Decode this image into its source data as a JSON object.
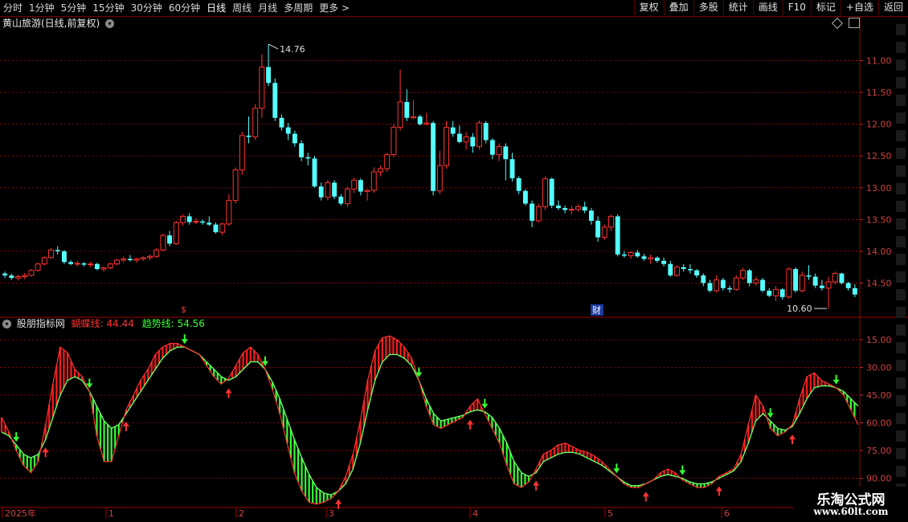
{
  "toolbar": {
    "periods": [
      "分时",
      "1分钟",
      "5分钟",
      "15分钟",
      "30分钟",
      "60分钟",
      "日线",
      "周线",
      "月线",
      "多周期",
      "更多 >"
    ],
    "active_period": "日线",
    "tools": [
      "复权",
      "叠加",
      "多股",
      "统计",
      "画线",
      "F10",
      "标记",
      "+自选",
      "返回"
    ]
  },
  "header": {
    "title": "黄山旅游(日线,前复权)"
  },
  "price_panel": {
    "y_ticks": [
      "14.50",
      "14.00",
      "13.50",
      "13.00",
      "12.50",
      "12.00",
      "11.50",
      "11.00"
    ],
    "high_label": "14.76",
    "low_label": "10.60",
    "markers": [
      "$",
      "财"
    ]
  },
  "indicator": {
    "name": "股朋指标网",
    "line1_label": "蝴蝶线: 44.44",
    "line2_label": "趋势线: 54.56",
    "y_ticks": [
      "90.00",
      "75.00",
      "60.00",
      "45.00",
      "30.00",
      "15.00"
    ]
  },
  "x_axis": {
    "labels": [
      "2025年",
      "1",
      "2",
      "3",
      "4",
      "5",
      "6"
    ]
  },
  "watermark": {
    "line1": "乐淘公式网",
    "line2": "www.60lt.com"
  },
  "colors": {
    "up": "#ff3232",
    "down": "#54ffff",
    "grid": "#8b0000",
    "indicator_up": "#ff1a1a",
    "indicator_down": "#33ff33",
    "trend_line": "#ff3333",
    "label_red": "#ff3333"
  },
  "chart_data": [
    {
      "type": "candlestick",
      "title": "黄山旅游(日线,前复权)",
      "ylim": [
        10.5,
        15.0
      ],
      "y_ticks": [
        11.0,
        11.5,
        12.0,
        12.5,
        13.0,
        13.5,
        14.0,
        14.5
      ],
      "max_price": 14.76,
      "min_price": 10.6,
      "ohlc": [
        [
          11.15,
          11.18,
          11.08,
          11.12
        ],
        [
          11.12,
          11.15,
          11.05,
          11.08
        ],
        [
          11.08,
          11.13,
          11.04,
          11.1
        ],
        [
          11.1,
          11.16,
          11.06,
          11.12
        ],
        [
          11.12,
          11.22,
          11.1,
          11.2
        ],
        [
          11.2,
          11.32,
          11.18,
          11.3
        ],
        [
          11.3,
          11.42,
          11.28,
          11.4
        ],
        [
          11.4,
          11.55,
          11.38,
          11.52
        ],
        [
          11.52,
          11.58,
          11.45,
          11.5
        ],
        [
          11.5,
          11.52,
          11.3,
          11.33
        ],
        [
          11.33,
          11.36,
          11.28,
          11.3
        ],
        [
          11.3,
          11.35,
          11.26,
          11.31
        ],
        [
          11.31,
          11.33,
          11.26,
          11.29
        ],
        [
          11.29,
          11.34,
          11.25,
          11.3
        ],
        [
          11.3,
          11.32,
          11.2,
          11.22
        ],
        [
          11.22,
          11.26,
          11.18,
          11.24
        ],
        [
          11.24,
          11.32,
          11.22,
          11.3
        ],
        [
          11.3,
          11.38,
          11.28,
          11.36
        ],
        [
          11.36,
          11.42,
          11.32,
          11.38
        ],
        [
          11.38,
          11.44,
          11.34,
          11.36
        ],
        [
          11.36,
          11.4,
          11.32,
          11.38
        ],
        [
          11.38,
          11.42,
          11.35,
          11.4
        ],
        [
          11.4,
          11.45,
          11.36,
          11.42
        ],
        [
          11.42,
          11.55,
          11.4,
          11.52
        ],
        [
          11.52,
          11.78,
          11.5,
          11.75
        ],
        [
          11.75,
          11.82,
          11.58,
          11.62
        ],
        [
          11.62,
          11.98,
          11.6,
          11.95
        ],
        [
          11.95,
          12.08,
          11.9,
          12.05
        ],
        [
          12.05,
          12.1,
          11.92,
          11.96
        ],
        [
          11.96,
          12.02,
          11.93,
          11.97
        ],
        [
          11.97,
          12.0,
          11.92,
          11.95
        ],
        [
          11.95,
          12.05,
          11.9,
          11.92
        ],
        [
          11.92,
          11.95,
          11.78,
          11.8
        ],
        [
          11.8,
          11.95,
          11.75,
          11.93
        ],
        [
          11.93,
          12.4,
          11.9,
          12.3
        ],
        [
          12.3,
          12.82,
          12.25,
          12.78
        ],
        [
          12.78,
          13.38,
          12.7,
          13.32
        ],
        [
          13.32,
          13.62,
          13.2,
          13.3
        ],
        [
          13.3,
          13.82,
          13.25,
          13.75
        ],
        [
          13.75,
          14.6,
          13.6,
          14.4
        ],
        [
          14.4,
          14.76,
          14.1,
          14.15
        ],
        [
          14.15,
          14.22,
          13.55,
          13.6
        ],
        [
          13.6,
          13.65,
          13.4,
          13.45
        ],
        [
          13.45,
          13.52,
          13.25,
          13.35
        ],
        [
          13.35,
          13.4,
          13.15,
          13.2
        ],
        [
          13.2,
          13.25,
          12.92,
          12.98
        ],
        [
          12.98,
          13.05,
          12.85,
          12.96
        ],
        [
          12.96,
          13.0,
          12.5,
          12.52
        ],
        [
          12.52,
          12.58,
          12.3,
          12.35
        ],
        [
          12.35,
          12.62,
          12.3,
          12.58
        ],
        [
          12.58,
          12.62,
          12.32,
          12.36
        ],
        [
          12.36,
          12.4,
          12.22,
          12.25
        ],
        [
          12.25,
          12.52,
          12.2,
          12.48
        ],
        [
          12.48,
          12.66,
          12.42,
          12.62
        ],
        [
          12.62,
          12.65,
          12.38,
          12.44
        ],
        [
          12.44,
          12.48,
          12.3,
          12.46
        ],
        [
          12.46,
          12.82,
          12.42,
          12.75
        ],
        [
          12.75,
          12.85,
          12.68,
          12.8
        ],
        [
          12.8,
          13.05,
          12.75,
          13.02
        ],
        [
          13.02,
          13.5,
          12.98,
          13.45
        ],
        [
          13.45,
          14.36,
          13.4,
          13.85
        ],
        [
          13.85,
          14.05,
          13.55,
          13.6
        ],
        [
          13.6,
          13.88,
          13.58,
          13.62
        ],
        [
          13.62,
          13.65,
          13.48,
          13.5
        ],
        [
          13.5,
          13.68,
          13.48,
          13.52
        ],
        [
          13.52,
          13.55,
          12.38,
          12.45
        ],
        [
          12.45,
          13.08,
          12.4,
          12.85
        ],
        [
          12.85,
          13.55,
          12.8,
          13.45
        ],
        [
          13.45,
          13.55,
          13.3,
          13.35
        ],
        [
          13.35,
          13.48,
          13.2,
          13.22
        ],
        [
          13.22,
          13.38,
          13.1,
          13.3
        ],
        [
          13.3,
          13.36,
          13.05,
          13.15
        ],
        [
          13.15,
          13.56,
          13.1,
          13.52
        ],
        [
          13.52,
          13.55,
          13.2,
          13.25
        ],
        [
          13.25,
          13.28,
          12.95,
          13.02
        ],
        [
          13.02,
          13.2,
          12.92,
          13.15
        ],
        [
          13.15,
          13.2,
          12.62,
          12.95
        ],
        [
          12.95,
          13.05,
          12.6,
          12.65
        ],
        [
          12.65,
          12.68,
          12.4,
          12.45
        ],
        [
          12.45,
          12.48,
          12.22,
          12.25
        ],
        [
          12.25,
          12.3,
          11.88,
          11.98
        ],
        [
          11.98,
          12.25,
          11.95,
          12.2
        ],
        [
          12.2,
          12.68,
          12.15,
          12.64
        ],
        [
          12.64,
          12.66,
          12.18,
          12.22
        ],
        [
          12.22,
          12.3,
          12.15,
          12.18
        ],
        [
          12.18,
          12.22,
          12.1,
          12.15
        ],
        [
          12.15,
          12.22,
          12.08,
          12.16
        ],
        [
          12.16,
          12.24,
          12.12,
          12.2
        ],
        [
          12.2,
          12.28,
          12.1,
          12.14
        ],
        [
          12.14,
          12.18,
          11.92,
          11.98
        ],
        [
          11.98,
          12.05,
          11.65,
          11.72
        ],
        [
          11.72,
          11.92,
          11.68,
          11.88
        ],
        [
          11.88,
          12.08,
          11.82,
          12.05
        ],
        [
          12.05,
          12.08,
          11.42,
          11.45
        ],
        [
          11.45,
          11.5,
          11.4,
          11.43
        ],
        [
          11.43,
          11.5,
          11.38,
          11.48
        ],
        [
          11.48,
          11.52,
          11.4,
          11.42
        ],
        [
          11.42,
          11.46,
          11.35,
          11.38
        ],
        [
          11.38,
          11.45,
          11.3,
          11.4
        ],
        [
          11.4,
          11.42,
          11.32,
          11.35
        ],
        [
          11.35,
          11.4,
          11.26,
          11.3
        ],
        [
          11.3,
          11.35,
          11.1,
          11.12
        ],
        [
          11.12,
          11.28,
          11.1,
          11.25
        ],
        [
          11.25,
          11.3,
          11.18,
          11.22
        ],
        [
          11.22,
          11.3,
          11.15,
          11.2
        ],
        [
          11.2,
          11.22,
          11.08,
          11.12
        ],
        [
          11.12,
          11.15,
          10.95,
          11.0
        ],
        [
          11.0,
          11.05,
          10.85,
          10.88
        ],
        [
          10.88,
          11.12,
          10.85,
          11.05
        ],
        [
          11.05,
          11.08,
          10.88,
          10.92
        ],
        [
          10.92,
          10.96,
          10.85,
          10.9
        ],
        [
          10.9,
          11.12,
          10.88,
          11.08
        ],
        [
          11.08,
          11.24,
          11.05,
          11.2
        ],
        [
          11.2,
          11.22,
          10.95,
          11.0
        ],
        [
          11.0,
          11.1,
          10.96,
          11.05
        ],
        [
          11.05,
          11.08,
          10.85,
          10.88
        ],
        [
          10.88,
          10.92,
          10.78,
          10.8
        ],
        [
          10.8,
          10.95,
          10.72,
          10.9
        ],
        [
          10.9,
          10.92,
          10.74,
          10.78
        ],
        [
          10.78,
          11.25,
          10.75,
          11.22
        ],
        [
          11.22,
          11.25,
          10.85,
          10.88
        ],
        [
          10.88,
          11.18,
          10.85,
          11.12
        ],
        [
          11.12,
          11.28,
          11.05,
          11.1
        ],
        [
          11.1,
          11.15,
          10.92,
          10.96
        ],
        [
          10.96,
          11.05,
          10.88,
          10.92
        ],
        [
          10.92,
          11.1,
          10.6,
          11.02
        ],
        [
          11.02,
          11.18,
          10.98,
          11.15
        ],
        [
          11.15,
          11.16,
          10.98,
          11.0
        ],
        [
          11.0,
          11.02,
          10.88,
          10.92
        ],
        [
          10.92,
          10.98,
          10.78,
          10.82
        ]
      ]
    },
    {
      "type": "line",
      "title": "股朋指标网",
      "ylim": [
        0,
        100
      ],
      "y_ticks": [
        15,
        30,
        45,
        60,
        75,
        90
      ],
      "series": [
        {
          "name": "蝴蝶线",
          "last": 44.44,
          "values": [
            48,
            40,
            30,
            22,
            18,
            24,
            44,
            66,
            86,
            83,
            74,
            70,
            62,
            38,
            24,
            24,
            38,
            52,
            60,
            68,
            74,
            82,
            86,
            88,
            88,
            86,
            84,
            82,
            76,
            70,
            66,
            69,
            76,
            83,
            86,
            82,
            74,
            63,
            50,
            34,
            18,
            8,
            2,
            1,
            2,
            4,
            8,
            16,
            28,
            46,
            68,
            84,
            91,
            92,
            90,
            86,
            80,
            68,
            54,
            44,
            42,
            44,
            46,
            48,
            54,
            58,
            50,
            42,
            34,
            22,
            12,
            10,
            13,
            20,
            28,
            30,
            33,
            34,
            32,
            30,
            29,
            27,
            24,
            20,
            16,
            12,
            10,
            10,
            12,
            14,
            18,
            20,
            18,
            14,
            12,
            10,
            10,
            12,
            16,
            18,
            20,
            28,
            44,
            60,
            54,
            42,
            38,
            40,
            44,
            58,
            70,
            72,
            68,
            66,
            64,
            60,
            52,
            44
          ]
        },
        {
          "name": "趋势线",
          "last": 54.56,
          "values": [
            40,
            38,
            33,
            28,
            26,
            28,
            36,
            48,
            60,
            68,
            70,
            68,
            62,
            54,
            46,
            42,
            44,
            50,
            56,
            62,
            68,
            74,
            80,
            84,
            86,
            86,
            84,
            82,
            78,
            74,
            70,
            68,
            70,
            74,
            78,
            78,
            74,
            67,
            58,
            47,
            36,
            26,
            17,
            10,
            7,
            6,
            8,
            12,
            20,
            34,
            52,
            68,
            78,
            82,
            82,
            80,
            76,
            68,
            58,
            50,
            46,
            47,
            48,
            49,
            51,
            52,
            51,
            48,
            42,
            34,
            24,
            18,
            16,
            18,
            24,
            26,
            28,
            29,
            29,
            28,
            26,
            24,
            22,
            19,
            16,
            13,
            11,
            11,
            12,
            14,
            16,
            17,
            16,
            15,
            13,
            12,
            12,
            13,
            15,
            17,
            19,
            24,
            34,
            46,
            50,
            46,
            42,
            41,
            43,
            50,
            58,
            64,
            65,
            65,
            64,
            62,
            58,
            54
          ]
        }
      ]
    }
  ]
}
